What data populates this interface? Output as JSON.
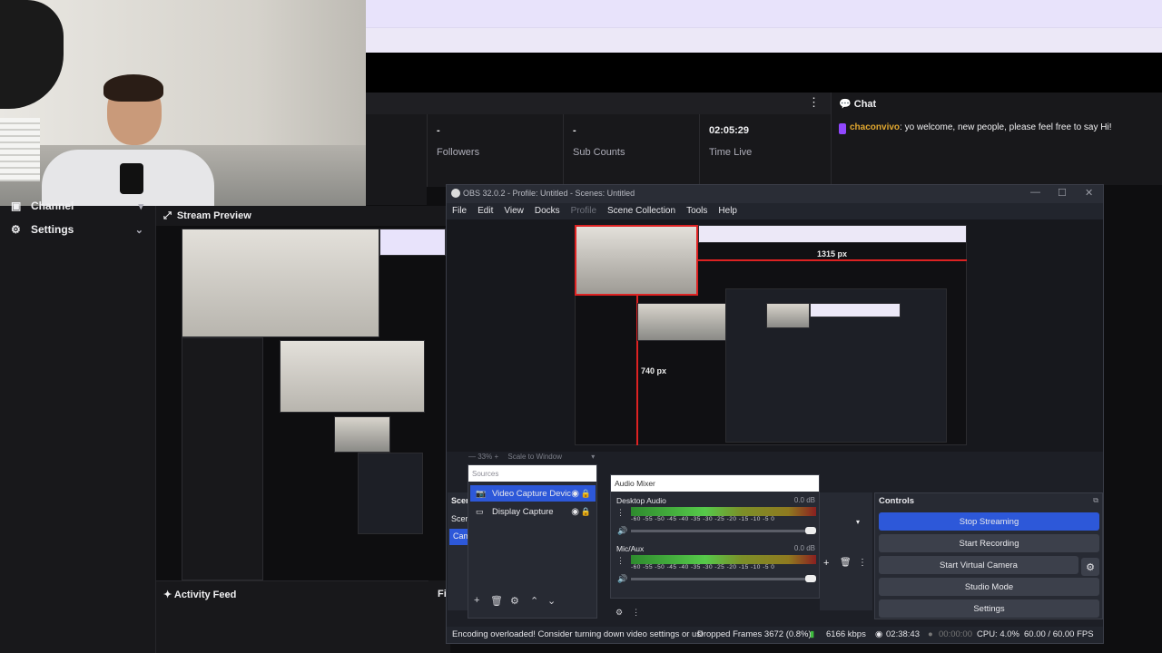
{
  "sidebar": {
    "items": [
      {
        "label": "Channel",
        "icon": "channel-icon"
      },
      {
        "label": "Settings",
        "icon": "gear-icon"
      }
    ]
  },
  "stats": [
    {
      "value": "-",
      "label": "Followers"
    },
    {
      "value": "-",
      "label": "Sub Counts"
    },
    {
      "value": "02:05:29",
      "label": "Time Live"
    }
  ],
  "chat": {
    "title": "Chat",
    "username": "chaconvivo",
    "message": ": yo welcome, new people, please feel free to say Hi!"
  },
  "stream_preview": {
    "title": "Stream Preview"
  },
  "activity_feed": {
    "title": "Activity Feed"
  },
  "obs": {
    "title": "OBS 32.0.2 - Profile: Untitled - Scenes: Untitled",
    "menu": [
      "File",
      "Edit",
      "View",
      "Docks",
      "Profile",
      "Scene Collection",
      "Tools",
      "Help"
    ],
    "preview_width_label": "1315 px",
    "preview_height_label": "740 px",
    "zoom": "33%",
    "scale_mode": "Scale to Window",
    "sources": {
      "header": "Sources",
      "items": [
        {
          "name": "Video Capture Devic",
          "icon": "camera-icon",
          "selected": true
        },
        {
          "name": "Display Capture",
          "icon": "monitor-icon",
          "selected": false
        }
      ]
    },
    "mixer": {
      "header": "Audio Mixer",
      "channels": [
        {
          "name": "Desktop Audio",
          "db": "0.0 dB",
          "volume": 1.0
        },
        {
          "name": "Mic/Aux",
          "db": "0.0 dB",
          "volume": 1.0
        }
      ],
      "ticks": "-60  -55  -50  -45  -40  -35  -30  -25  -20  -15  -10  -5  0"
    },
    "scenes": {
      "header": "Scen",
      "row1": "Scer",
      "row2": "Cam"
    },
    "controls": {
      "header": "Controls",
      "buttons": [
        "Stop Streaming",
        "Start Recording",
        "Start Virtual Camera",
        "Studio Mode",
        "Settings"
      ]
    },
    "status": {
      "message": "Encoding overloaded! Consider turning down video settings or usi",
      "dropped": "Dropped Frames 3672 (0.8%)",
      "bitrate": "6166 kbps",
      "stream_time": "02:38:43",
      "rec_time": "00:00:00",
      "cpu": "CPU: 4.0%",
      "fps": "60.00 / 60.00 FPS"
    }
  },
  "fi_label": "Fi"
}
